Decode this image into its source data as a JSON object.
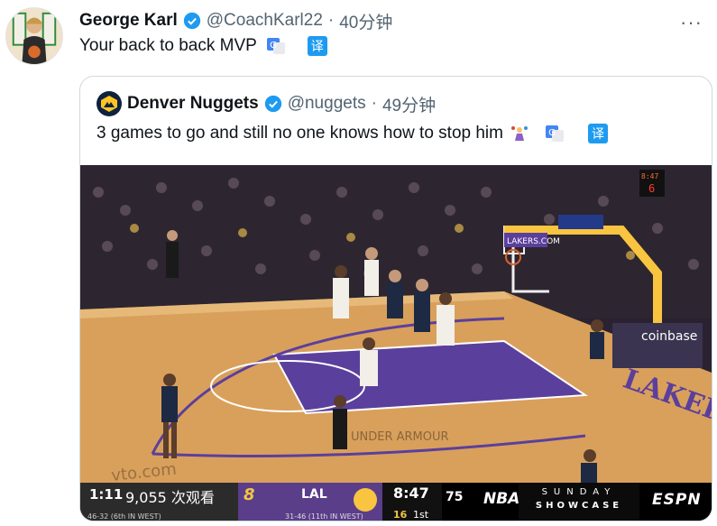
{
  "tweet": {
    "author_name": "George Karl",
    "author_handle": "@CoachKarl22",
    "separator": "·",
    "time": "40分钟",
    "text": "Your back to back MVP",
    "translate_label": "译",
    "more_label": "···"
  },
  "quote": {
    "author_name": "Denver Nuggets",
    "author_handle": "@nuggets",
    "separator": "·",
    "time": "49分钟",
    "text": "3 games to go and still no one knows how to stop him",
    "translate_label": "译"
  },
  "video": {
    "court_banner": "LAKERS.COM",
    "sponsor": "coinbase",
    "shot_clock_board": "8:47",
    "scorebug": {
      "broadcast_clock": "1:11",
      "views": "9,055 次观看",
      "den_score": "8",
      "den_record": "46-32 (6th IN WEST)",
      "lal_label": "LAL",
      "lal_record": "31-46 (11th IN WEST)",
      "game_clock": "8:47",
      "shot_clock": "16",
      "quarter": "1st",
      "anniversary": "75",
      "league": "NBA",
      "show_line1": "SUNDAY",
      "show_line2": "SHOWCASE",
      "network": "ESPN"
    }
  },
  "colors": {
    "verified": "#1d9bf0",
    "court_wood": "#d9a05b",
    "paint_purple": "#5b3f9c",
    "lakers_gold": "#f9c440"
  }
}
